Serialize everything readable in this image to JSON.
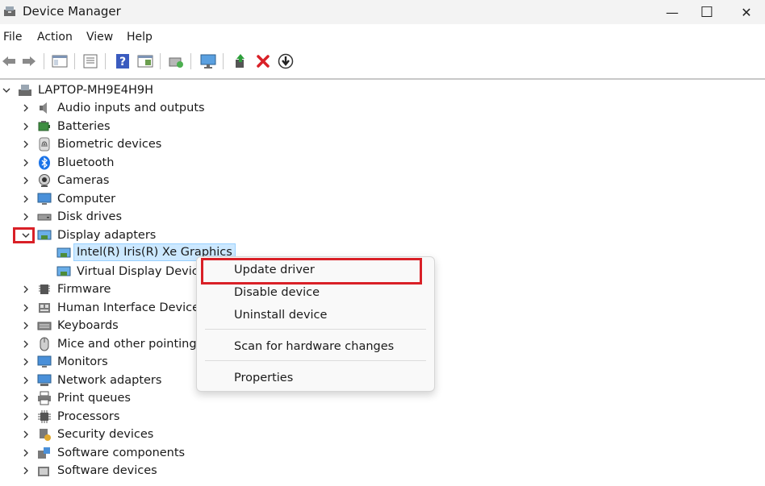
{
  "window": {
    "title": "Device Manager",
    "minimize": "—",
    "maximize": "☐",
    "close": "✕"
  },
  "menu": [
    "File",
    "Action",
    "View",
    "Help"
  ],
  "toolbar": [
    "back-icon",
    "forward-icon",
    "properties-pane-icon",
    "properties-icon",
    "help-icon",
    "view-icon",
    "scan-icon",
    "monitor-icon",
    "enable-icon",
    "uninstall-icon",
    "update-icon"
  ],
  "tree": {
    "root": "LAPTOP-MH9E4H9H",
    "categories": [
      "Audio inputs and outputs",
      "Batteries",
      "Biometric devices",
      "Bluetooth",
      "Cameras",
      "Computer",
      "Disk drives",
      "Display adapters",
      "Firmware",
      "Human Interface Devices",
      "Keyboards",
      "Mice and other pointing d",
      "Monitors",
      "Network adapters",
      "Print queues",
      "Processors",
      "Security devices",
      "Software components",
      "Software devices"
    ],
    "display_children": [
      "Intel(R) Iris(R) Xe Graphics",
      "Virtual Display Device"
    ]
  },
  "context_menu": {
    "update": "Update driver",
    "disable": "Disable device",
    "uninstall": "Uninstall device",
    "scan": "Scan for hardware changes",
    "properties": "Properties"
  },
  "colors": {
    "highlight_red": "#d92027",
    "selection_bg": "#cce8ff"
  }
}
